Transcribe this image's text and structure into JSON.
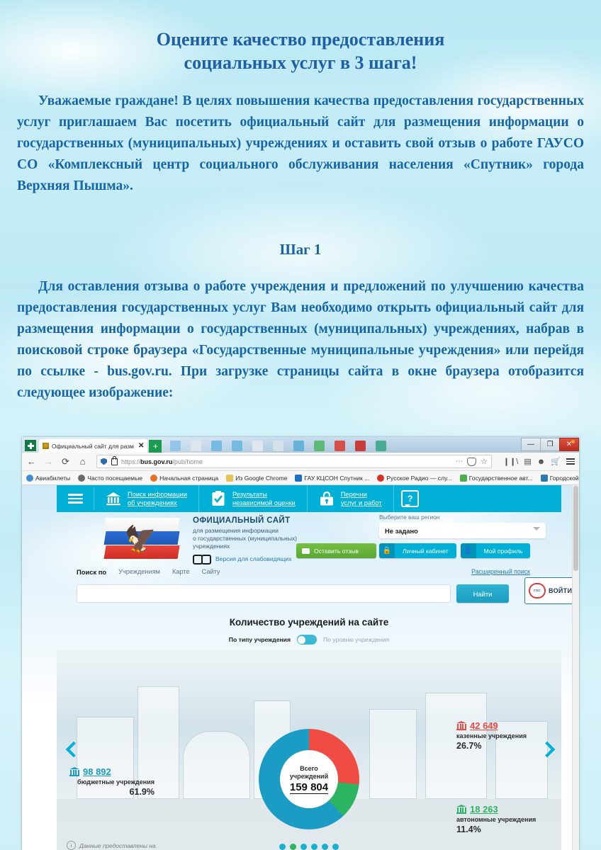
{
  "poster": {
    "title_line1": "Оцените качество предоставления",
    "title_line2": "социальных услуг в 3 шага!",
    "paragraph1": "Уважаемые граждане! В целях повышения качества предоставления государственных услуг приглашаем Вас посетить официальный сайт для размещения информации о государственных (муниципальных) учреждениях и оставить свой отзыв о работе ГАУСО СО «Комплексный центр социального обслуживания населения «Спутник» города Верхняя Пышма».",
    "step_heading": "Шаг 1",
    "paragraph2": "Для оставления отзыва о работе учреждения и предложений по улучшению качества предоставления государственных услуг Вам необходимо открыть официальный сайт для размещения информации о государственных (муниципальных) учреждениях, набрав в поисковой строке браузера «Государственные муниципальные учреждения» или перейдя по ссылке - bus.gov.ru. При загрузке страницы сайта в окне браузера отобразится следующее изображение:",
    "accent_color": "#1565a8"
  },
  "browser": {
    "tab_title": "Официальный сайт для разм",
    "tab_close": "✕",
    "new_tab": "+",
    "back": "←",
    "forward": "→",
    "reload": "⟳",
    "home": "⌂",
    "url_domain": "bus.gov.ru",
    "url_prefix": "https://",
    "url_path": "/pub/home",
    "more_actions": "⋯",
    "window_minimize": "—",
    "window_maximize": "❐",
    "window_close": "✕",
    "bookmarks": [
      {
        "label": "Авиабилеты",
        "color": "#3d8fd1"
      },
      {
        "label": "Часто посещаемые",
        "color": "#6b6b6b"
      },
      {
        "label": "Начальная страница",
        "color": "#e8702a"
      },
      {
        "label": "Из Google Chrome",
        "color": "#e8c35a"
      },
      {
        "label": "ГАУ КЦСОН Спутник ...",
        "color": "#1f6fc4"
      },
      {
        "label": "Русское Радио — слу...",
        "color": "#d93025"
      },
      {
        "label": "Государственное авт...",
        "color": "#49b04a"
      },
      {
        "label": "Городской информа...",
        "color": "#2b79b5"
      }
    ],
    "bookmarks_overflow": "»"
  },
  "site": {
    "nav": [
      {
        "label_line1": "Поиск информации",
        "label_line2": "об учреждениях",
        "icon": "bank-icon"
      },
      {
        "label_line1": "Результаты",
        "label_line2": "независимой оценки",
        "icon": "clipboard-check-icon"
      },
      {
        "label_line1": "Перечни",
        "label_line2": "услуг и работ",
        "icon": "briefcase-lock-icon"
      }
    ],
    "help_label": "?",
    "header": {
      "title": "ОФИЦИАЛЬНЫЙ САЙТ",
      "subtitle_line1": "для размещения информации",
      "subtitle_line2": "о государственных (муниципальных)",
      "subtitle_line3": "учреждениях",
      "low_vision": "Версия для слабовидящих",
      "feedback_button": "Оставить отзыв"
    },
    "region": {
      "label": "Выберите ваш регион",
      "selected": "Не задано"
    },
    "account": {
      "cabinet": "Личный кабинет",
      "profile": "Мой профиль"
    },
    "gosuslugi": {
      "login": "ВОЙТИ",
      "logo_text": "ГОС УСЛУГИ"
    },
    "search": {
      "label": "Поиск по",
      "tabs": [
        "Учреждениям",
        "Карте",
        "Сайту"
      ],
      "advanced": "Расширенный поиск",
      "input_value": "",
      "input_placeholder": "",
      "button": "Найти"
    },
    "stats": {
      "title": "Количество учреждений на сайте",
      "toggle_left": "По типу учреждения",
      "toggle_right": "По уровню учреждения",
      "center_label_line1": "Всего",
      "center_label_line2": "учреждений",
      "center_value": "159 804",
      "footnote": "Данные предоставлены на",
      "arrow_prev": "‹",
      "arrow_next": "›"
    }
  },
  "chart_data": {
    "type": "pie",
    "title": "Количество учреждений на сайте",
    "total_label": "Всего учреждений",
    "total": 159804,
    "total_display": "159 804",
    "legend_position": "around",
    "categories": [
      "бюджетные учреждения",
      "казенные учреждения",
      "автономные учреждения"
    ],
    "values": [
      98892,
      42649,
      18263
    ],
    "value_displays": [
      "98 892",
      "42 649",
      "18 263"
    ],
    "percents": [
      61.9,
      26.7,
      11.4
    ],
    "percent_displays": [
      "61.9%",
      "26.7%",
      "11.4%"
    ],
    "colors": [
      "#1b9cc4",
      "#ef4b42",
      "#2cb463"
    ],
    "segments": [
      {
        "name": "бюджетные учреждения",
        "value": 98892,
        "value_display": "98 892",
        "percent_display": "61.9%",
        "color": "#1b9cc4"
      },
      {
        "name": "казенные учреждения",
        "value": 42649,
        "value_display": "42 649",
        "percent_display": "26.7%",
        "color": "#ef4b42"
      },
      {
        "name": "автономные учреждения",
        "value": 18263,
        "value_display": "18 263",
        "percent_display": "11.4%",
        "color": "#2cb463"
      }
    ]
  }
}
